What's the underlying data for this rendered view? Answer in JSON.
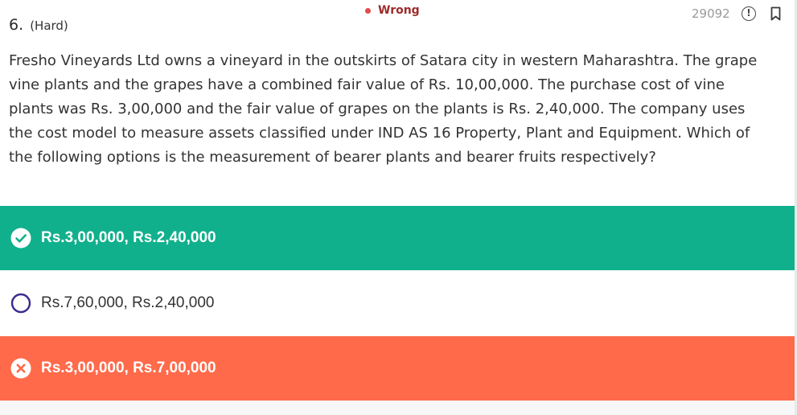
{
  "question": {
    "number": "6.",
    "difficulty": "(Hard)",
    "text": "Fresho Vineyards Ltd owns a vineyard in the outskirts of Satara city in western Maharashtra. The grape vine plants and the grapes have a combined fair value of Rs. 10,00,000. The purchase cost of vine plants was Rs. 3,00,000 and the fair value of grapes on the plants is Rs. 2,40,000. The company uses the cost model to measure assets classified under IND AS 16 Property, Plant and Equipment. Which of the following options is the measurement of bearer plants and bearer fruits respectively?"
  },
  "status": {
    "label": "Wrong",
    "dot_color": "#e14b4b"
  },
  "question_id": "29092",
  "icons": {
    "report": "exclamation-circle-icon",
    "bookmark": "bookmark-icon"
  },
  "options": [
    {
      "label": "Rs.3,00,000, Rs.2,40,000",
      "state": "correct",
      "color": "#11b08c"
    },
    {
      "label": "Rs.7,60,000, Rs.2,40,000",
      "state": "unselected",
      "color": "#ffffff"
    },
    {
      "label": "Rs.3,00,000, Rs.7,00,000",
      "state": "wrong",
      "color": "#ff6a4a"
    }
  ]
}
